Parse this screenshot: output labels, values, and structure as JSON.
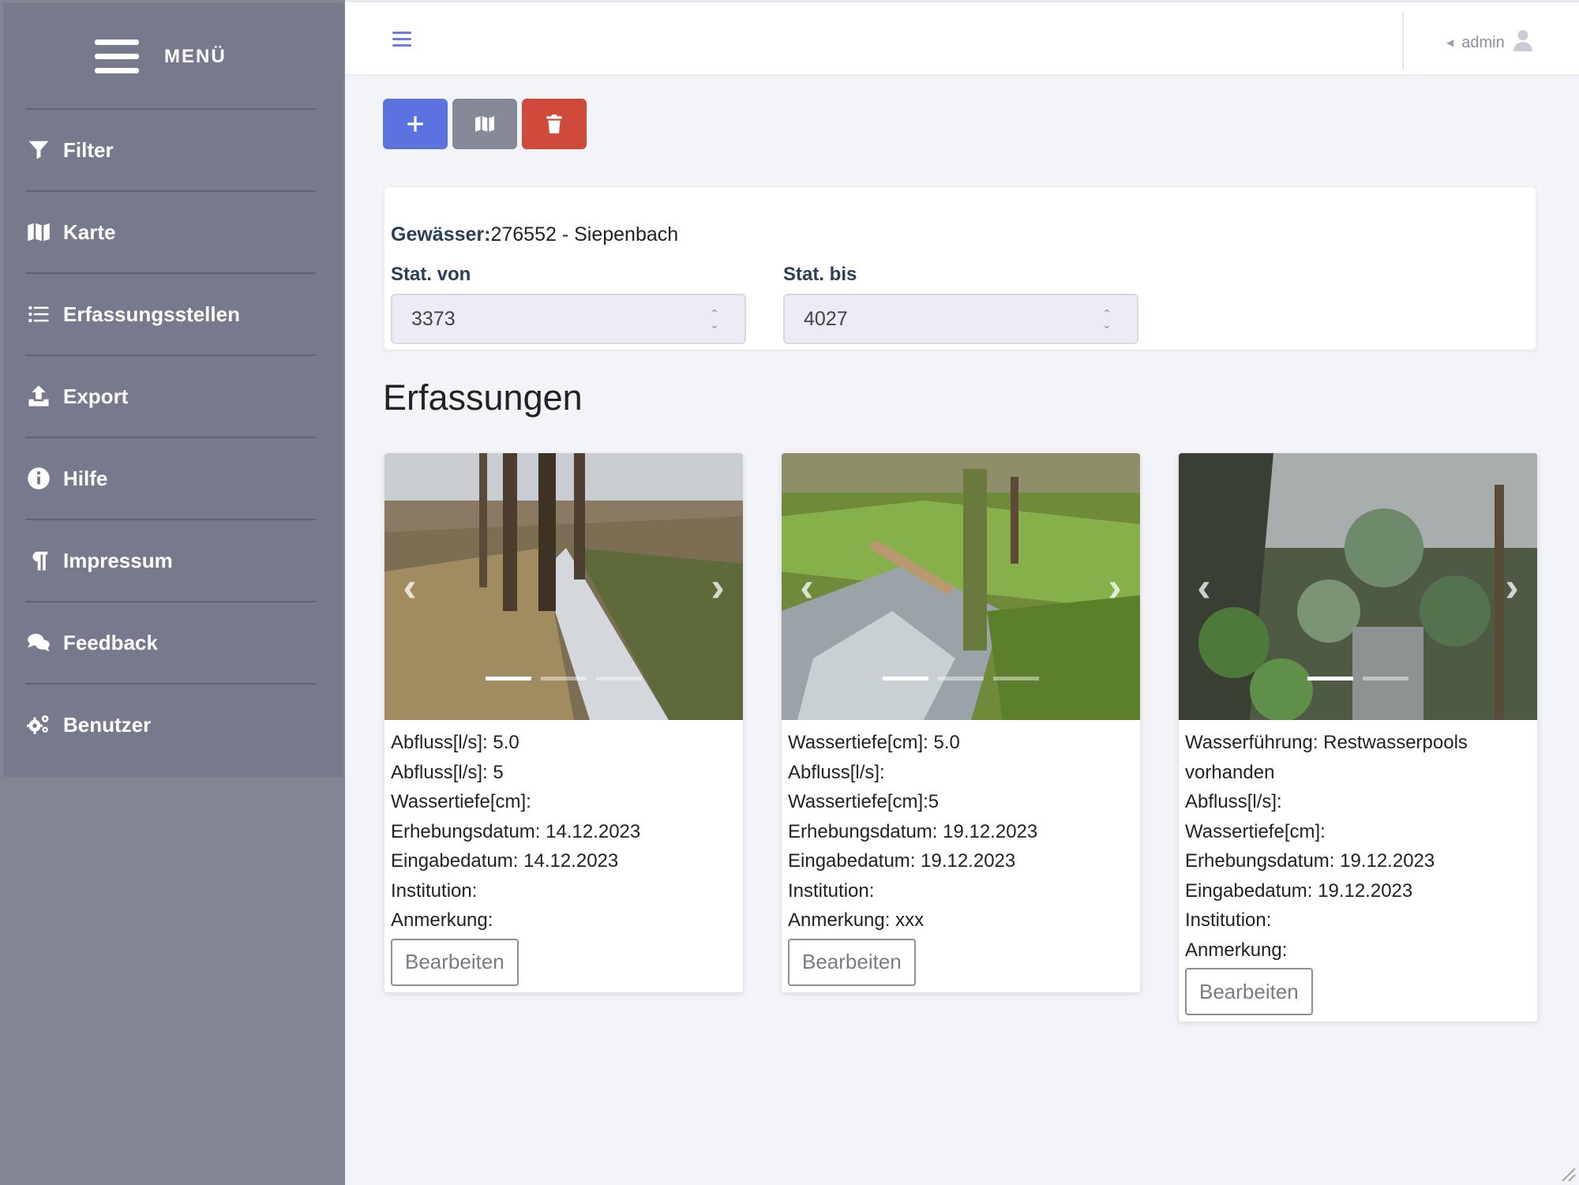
{
  "sidebar": {
    "menu_title": "MENÜ",
    "items": [
      {
        "label": "Filter",
        "icon": "filter-icon"
      },
      {
        "label": "Karte",
        "icon": "map-icon"
      },
      {
        "label": "Erfassungsstellen",
        "icon": "list-icon"
      },
      {
        "label": "Export",
        "icon": "upload-icon"
      },
      {
        "label": "Hilfe",
        "icon": "info-icon"
      },
      {
        "label": "Impressum",
        "icon": "paragraph-icon"
      },
      {
        "label": "Feedback",
        "icon": "comments-icon"
      },
      {
        "label": "Benutzer",
        "icon": "gears-icon"
      }
    ]
  },
  "topbar": {
    "user": "admin"
  },
  "toolbar": {
    "add_icon": "plus-icon",
    "map_icon": "map-icon",
    "delete_icon": "trash-icon"
  },
  "filter": {
    "gewaesser_label": "Gewässer:",
    "gewaesser_value": "276552 - Siepenbach",
    "stat_von_label": "Stat. von",
    "stat_von_value": "3373",
    "stat_bis_label": "Stat. bis",
    "stat_bis_value": "4027"
  },
  "section_title": "Erfassungen",
  "cards": [
    {
      "lines": [
        "Abfluss[l/s]: 5.0",
        "Abfluss[l/s]: 5",
        "Wassertiefe[cm]:",
        "Erhebungsdatum: 14.12.2023",
        "Eingabedatum: 14.12.2023",
        "Institution:",
        "Anmerkung:"
      ],
      "edit_label": "Bearbeiten",
      "slides": 3,
      "active_slide": 1
    },
    {
      "lines": [
        "Wassertiefe[cm]: 5.0",
        "Abfluss[l/s]:",
        "Wassertiefe[cm]:5",
        "Erhebungsdatum: 19.12.2023",
        "Eingabedatum: 19.12.2023",
        "Institution:",
        "Anmerkung: xxx"
      ],
      "edit_label": "Bearbeiten",
      "slides": 3,
      "active_slide": 1
    },
    {
      "lines": [
        "Wasserführung: Restwasserpools",
        "vorhanden",
        "Abfluss[l/s]:",
        "Wassertiefe[cm]:",
        "Erhebungsdatum: 19.12.2023",
        "Eingabedatum: 19.12.2023",
        "Institution:",
        "Anmerkung:"
      ],
      "edit_label": "Bearbeiten",
      "slides": 2,
      "active_slide": 1
    }
  ],
  "colors": {
    "sidebar_bg": "#777a8d",
    "primary": "#5b72df",
    "secondary": "#868a98",
    "danger": "#cf4a3b",
    "label_text": "#2b3f55"
  }
}
